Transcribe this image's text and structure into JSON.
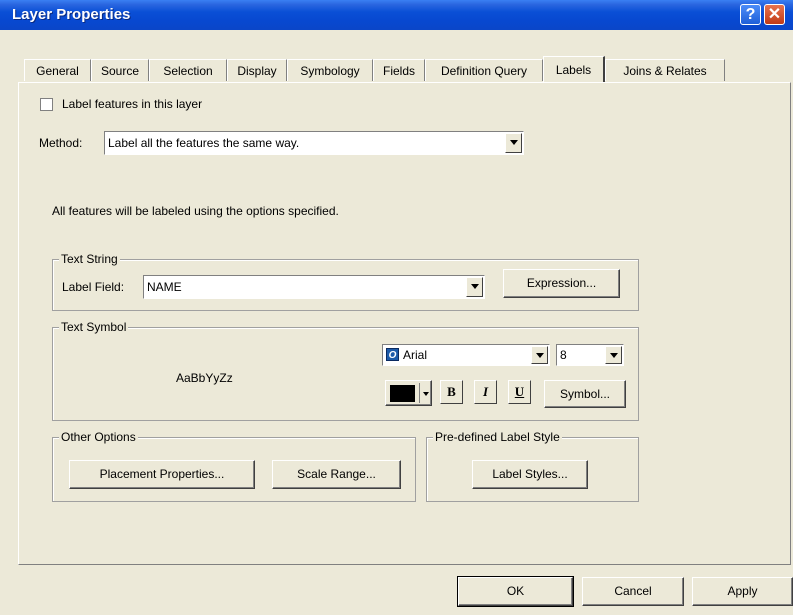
{
  "window": {
    "title": "Layer Properties",
    "help_glyph": "?",
    "close_glyph": "✕"
  },
  "tabs": [
    {
      "label": "General",
      "active": false
    },
    {
      "label": "Source",
      "active": false
    },
    {
      "label": "Selection",
      "active": false
    },
    {
      "label": "Display",
      "active": false
    },
    {
      "label": "Symbology",
      "active": false
    },
    {
      "label": "Fields",
      "active": false
    },
    {
      "label": "Definition Query",
      "active": false
    },
    {
      "label": "Labels",
      "active": true
    },
    {
      "label": "Joins & Relates",
      "active": false
    }
  ],
  "labels_tab": {
    "label_features_checkbox": {
      "label": "Label features in this layer",
      "checked": false
    },
    "method": {
      "label": "Method:",
      "value": "Label all the features the same way."
    },
    "description": "All features will be labeled using the options specified.",
    "text_string": {
      "title": "Text String",
      "label_field_label": "Label Field:",
      "label_field_value": "NAME",
      "expression_button": "Expression..."
    },
    "text_symbol": {
      "title": "Text Symbol",
      "preview": "AaBbYyZz",
      "font_icon": "O",
      "font_value": "Arial",
      "size_value": "8",
      "color": "#000000",
      "bold": "B",
      "italic": "I",
      "underline": "U",
      "symbol_button": "Symbol..."
    },
    "other_options": {
      "title": "Other Options",
      "placement_button": "Placement Properties...",
      "scale_range_button": "Scale Range..."
    },
    "predefined_style": {
      "title": "Pre-defined Label Style",
      "label_styles_button": "Label Styles..."
    }
  },
  "footer": {
    "ok": "OK",
    "cancel": "Cancel",
    "apply": "Apply"
  }
}
